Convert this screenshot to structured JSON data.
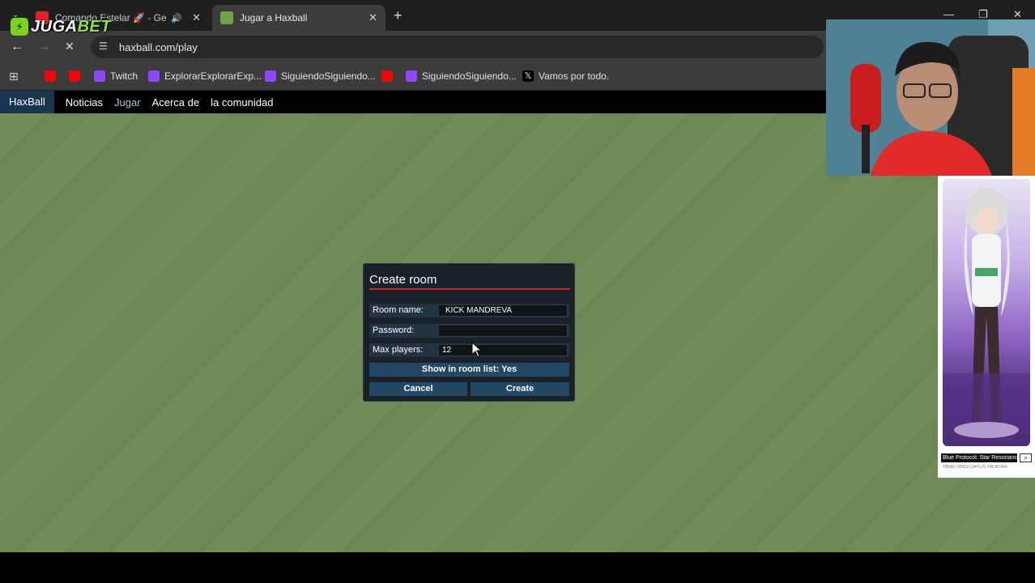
{
  "browser": {
    "tabs": [
      {
        "title": "Comando Estelar 🚀 - Germ",
        "favicon_color": "#e02424"
      },
      {
        "title": "Jugar a Haxball",
        "favicon_color": "#6fa34a"
      }
    ],
    "url": "haxball.com/play",
    "bookmarks": [
      {
        "label": "",
        "icon": "youtube-icon"
      },
      {
        "label": "",
        "icon": "youtube-icon"
      },
      {
        "label": "Twitch",
        "icon": "twitch-icon"
      },
      {
        "label": "ExplorarExplorarExp...",
        "icon": "twitch-icon"
      },
      {
        "label": "SiguiendoSiguiendo...",
        "icon": "twitch-icon"
      },
      {
        "label": "",
        "icon": "youtube-icon"
      },
      {
        "label": "SiguiendoSiguiendo...",
        "icon": "twitch-icon"
      },
      {
        "label": "Vamos por todo.",
        "icon": "x-icon"
      }
    ]
  },
  "site": {
    "logo": "HaxBall",
    "nav": [
      "Noticias",
      "Jugar",
      "Acerca de",
      "la comunidad"
    ],
    "active": "Jugar"
  },
  "dialog": {
    "title": "Create room",
    "room_name_label": "Room name:",
    "room_name_value": "KICK MANDREVA",
    "password_label": "Password:",
    "password_value": "",
    "max_players_label": "Max players:",
    "max_players_value": "12",
    "show_in_list": "Show in room list: Yes",
    "cancel": "Cancel",
    "create": "Create"
  },
  "overlay": {
    "brand_part1": "JUGA",
    "brand_part2": "BET",
    "ad_caption": "Blue Protocol: Star Resonance",
    "ad_small": "©BNEI ©BNSI CAPLUS ©BOKURA"
  },
  "colors": {
    "field": "#718c5a",
    "dialog_bg": "#1a2129",
    "button": "#244967",
    "accent_line": "#c1292e"
  }
}
